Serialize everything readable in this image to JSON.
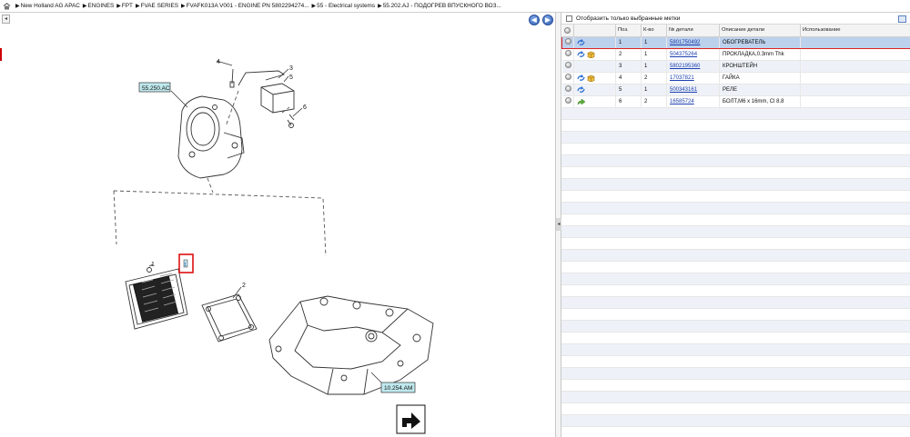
{
  "breadcrumb": [
    "New Holland AG APAC",
    "ENGINES",
    "FPT",
    "FVAE SERIES",
    "FVAFK013A V001 - ENGINE PN 5802294274...",
    "55 - Electrical systems",
    "55.202.AJ - ПОДОГРЕВ ВПУСКНОГО ВОЗ..."
  ],
  "nav": {
    "back": "◀",
    "forward": "▶",
    "collapse": "◂"
  },
  "drawing": {
    "callouts": [
      "1",
      "2",
      "3",
      "4",
      "5",
      "6"
    ],
    "ref_labels": [
      "55.250.AC",
      "10.254.AM"
    ],
    "hotspot_label": "1"
  },
  "filter": {
    "label": "Отобразить только выбранные метки"
  },
  "table": {
    "headers": [
      "",
      "",
      "Поз.",
      "К-во",
      "№ детали",
      "Описание детали",
      "Использование"
    ],
    "rows": [
      {
        "pos": "1",
        "qty": "1",
        "part": "5801750492",
        "desc": "ОБОГРЕВАТЕЛЬ",
        "usage": "",
        "icons": [
          "refresh-icon"
        ],
        "selected": true
      },
      {
        "pos": "2",
        "qty": "1",
        "part": "504375264",
        "desc": "ПРОКЛАДКА,0.3mm Thk",
        "usage": "",
        "icons": [
          "refresh-icon",
          "package-icon"
        ],
        "selected": false
      },
      {
        "pos": "3",
        "qty": "1",
        "part": "5802195360",
        "desc": "КРОНШТЕЙН",
        "usage": "",
        "icons": [],
        "selected": false
      },
      {
        "pos": "4",
        "qty": "2",
        "part": "17037821",
        "desc": "ГАЙКА",
        "usage": "",
        "icons": [
          "refresh-icon",
          "package-icon"
        ],
        "selected": false
      },
      {
        "pos": "5",
        "qty": "1",
        "part": "500343161",
        "desc": "РЕЛЕ",
        "usage": "",
        "icons": [
          "refresh-icon"
        ],
        "selected": false
      },
      {
        "pos": "6",
        "qty": "2",
        "part": "16585724",
        "desc": "БОЛТ,M6 x 16mm, Cl 8.8",
        "usage": "",
        "icons": [
          "arrow-forward-icon"
        ],
        "selected": false
      }
    ]
  },
  "colors": {
    "accent": "#2f5eb4",
    "selected_row": "#bcd1ec",
    "highlight": "#dd1111",
    "link": "#1b3fb0",
    "ref_label_bg": "#bfe9ee"
  }
}
